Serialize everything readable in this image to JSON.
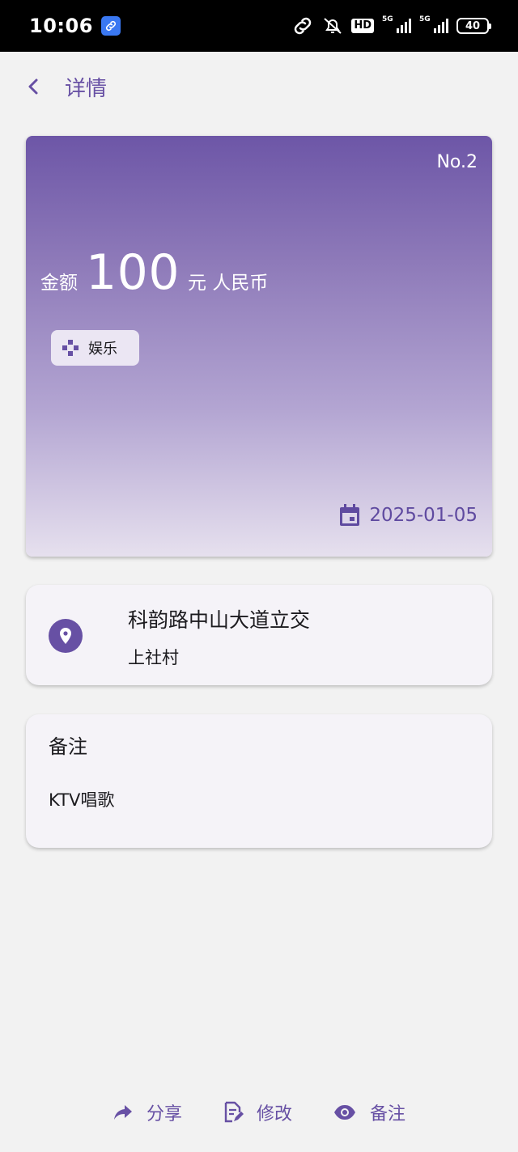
{
  "status_bar": {
    "time": "10:06",
    "hd_label": "HD",
    "signal1_tag": "5G",
    "signal2_tag": "5G",
    "battery": "40"
  },
  "app_bar": {
    "back_icon": "chevron-left-icon",
    "title": "详情"
  },
  "hero": {
    "record_no": "No.2",
    "amount_label": "金额",
    "amount_value": "100",
    "amount_unit": "元 人民币",
    "category": {
      "icon": "gamepad-icon",
      "label": "娱乐"
    },
    "date": "2025-01-05"
  },
  "location": {
    "icon": "location-pin-icon",
    "main": "科韵路中山大道立交",
    "sub": "上社村"
  },
  "note": {
    "title": "备注",
    "body": "KTV唱歌"
  },
  "actions": [
    {
      "icon": "share-icon",
      "label": "分享"
    },
    {
      "icon": "edit-note-icon",
      "label": "修改"
    },
    {
      "icon": "eye-icon",
      "label": "备注"
    }
  ],
  "colors": {
    "primary": "#6750a4",
    "background": "#f2f2f2",
    "card": "#f5f3f8"
  }
}
